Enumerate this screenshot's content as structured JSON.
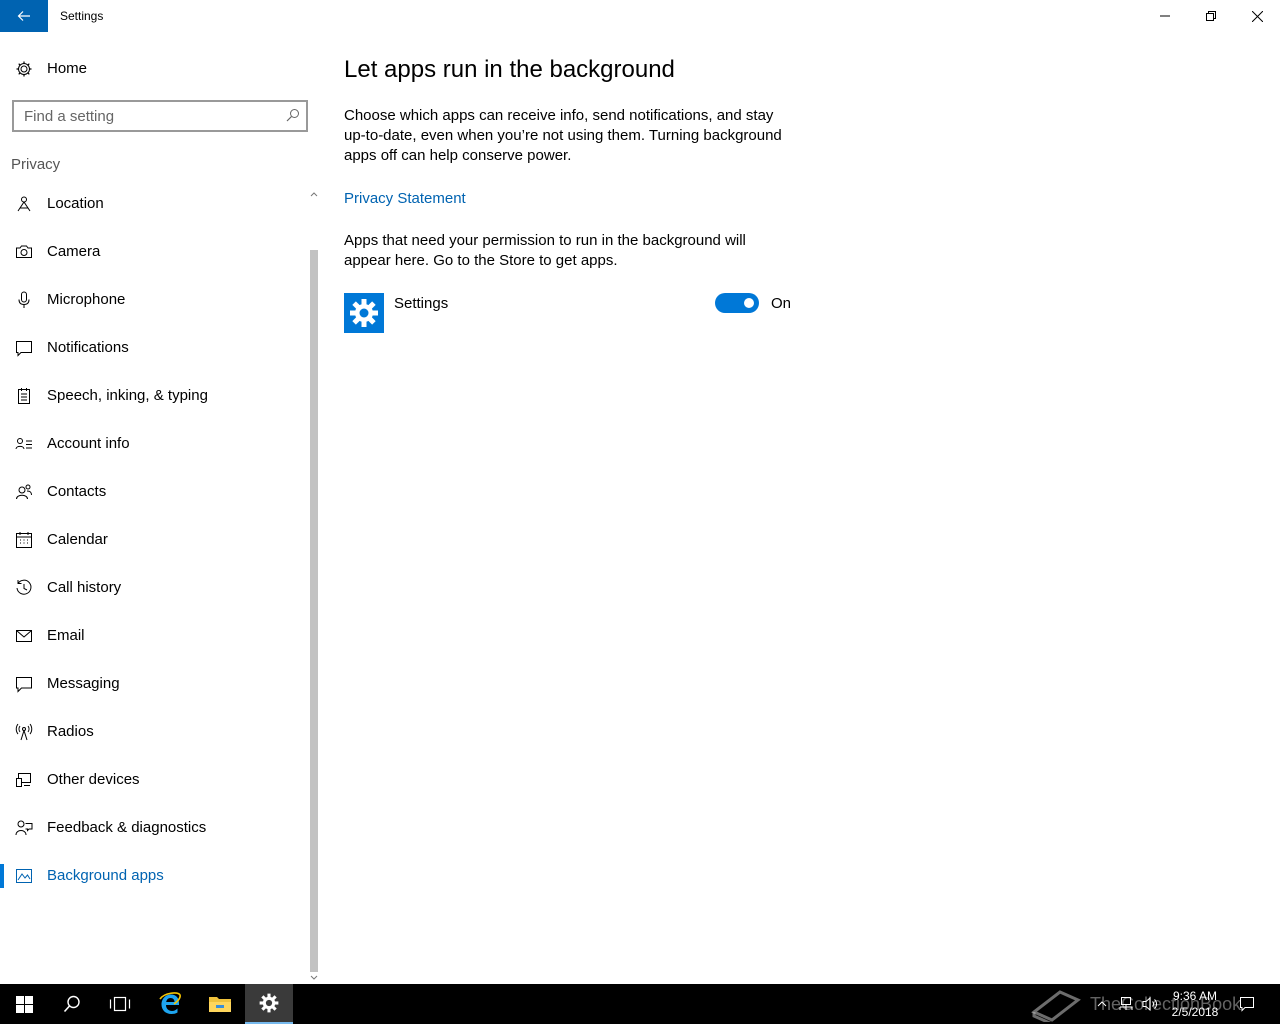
{
  "window": {
    "title": "Settings",
    "accent_color": "#0063b1"
  },
  "sidebar": {
    "home_label": "Home",
    "search_placeholder": "Find a setting",
    "section_label": "Privacy",
    "items": [
      {
        "label": "Location",
        "icon": "location-icon"
      },
      {
        "label": "Camera",
        "icon": "camera-icon"
      },
      {
        "label": "Microphone",
        "icon": "microphone-icon"
      },
      {
        "label": "Notifications",
        "icon": "notifications-icon"
      },
      {
        "label": "Speech, inking, & typing",
        "icon": "speech-icon"
      },
      {
        "label": "Account info",
        "icon": "account-info-icon"
      },
      {
        "label": "Contacts",
        "icon": "contacts-icon"
      },
      {
        "label": "Calendar",
        "icon": "calendar-icon"
      },
      {
        "label": "Call history",
        "icon": "call-history-icon"
      },
      {
        "label": "Email",
        "icon": "email-icon"
      },
      {
        "label": "Messaging",
        "icon": "messaging-icon"
      },
      {
        "label": "Radios",
        "icon": "radios-icon"
      },
      {
        "label": "Other devices",
        "icon": "other-devices-icon"
      },
      {
        "label": "Feedback & diagnostics",
        "icon": "feedback-icon"
      },
      {
        "label": "Background apps",
        "icon": "background-apps-icon",
        "active": true
      }
    ]
  },
  "main": {
    "title": "Let apps run in the background",
    "description": "Choose which apps can receive info, send notifications, and stay up-to-date, even when you’re not using them. Turning background apps off can help conserve power.",
    "privacy_link": "Privacy Statement",
    "permission_note": "Apps that need your permission to run in the background will appear here. Go to the Store to get apps.",
    "apps": [
      {
        "name": "Settings",
        "icon": "settings-gear-icon",
        "toggle_on": true,
        "state_label": "On"
      }
    ]
  },
  "taskbar": {
    "time": "9:36 AM",
    "date": "2/5/2018",
    "watermark": "TheCollectionBook"
  }
}
